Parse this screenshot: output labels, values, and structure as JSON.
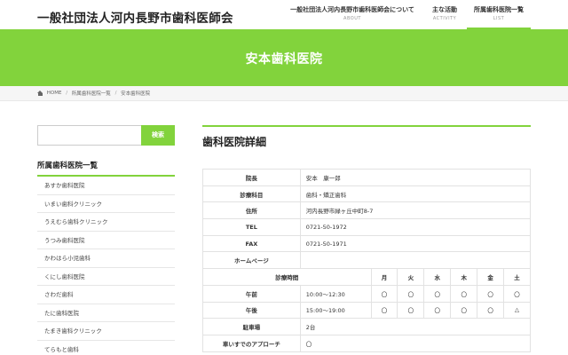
{
  "header": {
    "site_title": "一般社団法人河内長野市歯科医師会",
    "nav": [
      {
        "label": "一般社団法人河内長野市歯科医師会について",
        "sub": "ABOUT"
      },
      {
        "label": "主な活動",
        "sub": "ACTIVITY"
      },
      {
        "label": "所属歯科医院一覧",
        "sub": "LIST"
      }
    ],
    "accent_color": "#82d33c"
  },
  "hero": {
    "title": "安本歯科医院"
  },
  "breadcrumb": {
    "home": "HOME",
    "level1": "所属歯科医院一覧",
    "current": "安本歯科医院",
    "separator": "/"
  },
  "sidebar": {
    "search_placeholder": "",
    "search_button": "検索",
    "title": "所属歯科医院一覧",
    "items": [
      "あすか歯科医院",
      "いまい歯科クリニック",
      "うえむら歯科クリニック",
      "うつみ歯科医院",
      "かわはら小児歯科",
      "くにし歯科医院",
      "さわだ歯科",
      "たに歯科医院",
      "たまき歯科クリニック",
      "てらもと歯科"
    ]
  },
  "main": {
    "title": "歯科医院詳細",
    "rows": {
      "director": {
        "label": "院長",
        "value": "安本　康一郎"
      },
      "department": {
        "label": "診療科目",
        "value": "歯科・矯正歯科"
      },
      "address": {
        "label": "住所",
        "value": "河内長野市緑ヶ丘中町8-7"
      },
      "tel": {
        "label": "TEL",
        "value": "0721-50-1972"
      },
      "fax": {
        "label": "FAX",
        "value": "0721-50-1971"
      },
      "homepage": {
        "label": "ホームページ",
        "value": ""
      },
      "parking": {
        "label": "駐車場",
        "value": "2台"
      },
      "wheelchair": {
        "label": "車いすでのアプローチ",
        "value": "〇"
      }
    },
    "schedule": {
      "label": "診療時間",
      "days": [
        "月",
        "火",
        "水",
        "木",
        "金",
        "土"
      ],
      "am": {
        "label": "午前",
        "hours": "10:00〜12:30",
        "marks": [
          "〇",
          "〇",
          "〇",
          "〇",
          "〇",
          "〇"
        ]
      },
      "pm": {
        "label": "午後",
        "hours": "15:00〜19:00",
        "marks": [
          "〇",
          "〇",
          "〇",
          "〇",
          "〇",
          "△"
        ]
      }
    }
  }
}
